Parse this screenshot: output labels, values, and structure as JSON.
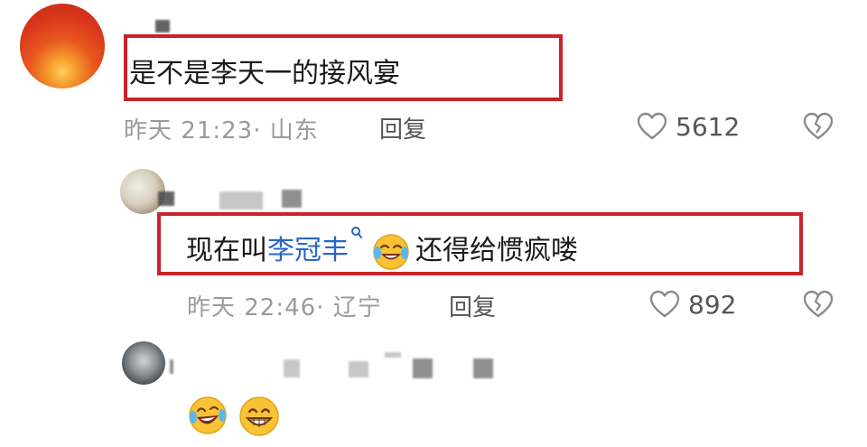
{
  "comment1": {
    "text": "是不是李天一的接风宴",
    "time": "昨天 21:23· 山东",
    "reply_label": "回复",
    "likes": "5612"
  },
  "comment2": {
    "text_before": "现在叫",
    "link_text": "李冠丰",
    "text_after": "还得给惯疯喽",
    "time": "昨天 22:46· 辽宁",
    "reply_label": "回复",
    "likes": "892"
  },
  "colors": {
    "highlight_box": "#c8242a",
    "link": "#2a64c8",
    "meta": "#9a9a9a"
  },
  "icons": [
    "heart-outline-icon",
    "broken-heart-icon",
    "search-link-icon",
    "laugh-cry-emoji-icon",
    "grin-emoji-icon"
  ]
}
